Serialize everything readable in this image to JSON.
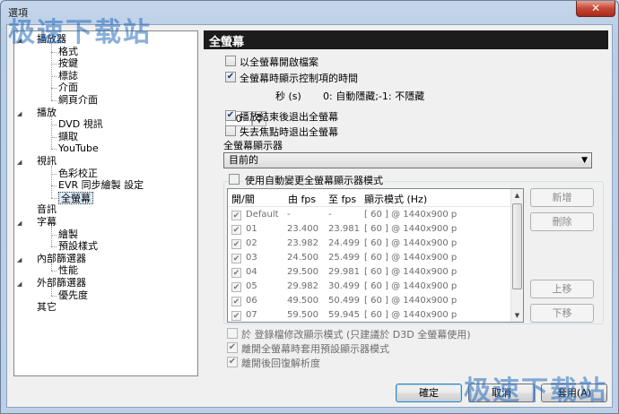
{
  "window": {
    "title": "選項",
    "close_glyph": "✕"
  },
  "watermark": "极速下载站",
  "tree": {
    "items": [
      {
        "label": "播放器",
        "indent": 0,
        "expanded": true
      },
      {
        "label": "格式",
        "indent": 1
      },
      {
        "label": "按鍵",
        "indent": 1
      },
      {
        "label": "標誌",
        "indent": 1
      },
      {
        "label": "介面",
        "indent": 1
      },
      {
        "label": "網頁介面",
        "indent": 1
      },
      {
        "label": "播放",
        "indent": 0,
        "expanded": true
      },
      {
        "label": "DVD 視訊",
        "indent": 1
      },
      {
        "label": "擷取",
        "indent": 1
      },
      {
        "label": "YouTube",
        "indent": 1
      },
      {
        "label": "視訊",
        "indent": 0,
        "expanded": true
      },
      {
        "label": "色彩校正",
        "indent": 1
      },
      {
        "label": "EVR 同步繪製 設定",
        "indent": 1
      },
      {
        "label": "全螢幕",
        "indent": 1,
        "selected": true
      },
      {
        "label": "音訊",
        "indent": 0
      },
      {
        "label": "字幕",
        "indent": 0,
        "expanded": true
      },
      {
        "label": "繪製",
        "indent": 1
      },
      {
        "label": "預設樣式",
        "indent": 1
      },
      {
        "label": "內部篩選器",
        "indent": 0,
        "expanded": true
      },
      {
        "label": "性能",
        "indent": 1
      },
      {
        "label": "外部篩選器",
        "indent": 0,
        "expanded": true
      },
      {
        "label": "優先度",
        "indent": 1
      },
      {
        "label": "其它",
        "indent": 0
      }
    ]
  },
  "panel": {
    "title": "全螢幕",
    "open_fullscreen": {
      "label": "以全螢幕開啟檔案",
      "checked": false
    },
    "show_controls_time": {
      "label": "全螢幕時顯示控制項的時間",
      "checked": true
    },
    "time_value": "0",
    "time_unit": "秒 (s)",
    "time_hint": "0: 自動隱藏;-1: 不隱藏",
    "exit_after_play": {
      "label": "播放結束後退出全螢幕",
      "checked": true
    },
    "exit_on_focus_loss": {
      "label": "失去焦點時退出全螢幕",
      "checked": false
    },
    "monitor_label": "全螢幕顯示器",
    "monitor_value": "目前的",
    "auto_change": {
      "label": "使用自動變更全螢幕顯示器模式",
      "checked": false
    },
    "list": {
      "headers": [
        "開/關",
        "由 fps",
        "至 fps",
        "顯示模式 (Hz)"
      ],
      "rows": [
        {
          "name": "Default",
          "from": "-",
          "to": "-",
          "mode": "[ 60 ]  @ 1440x900 p"
        },
        {
          "name": "01",
          "from": "23.400",
          "to": "23.981",
          "mode": "[ 60 ]  @ 1440x900 p"
        },
        {
          "name": "02",
          "from": "23.982",
          "to": "24.499",
          "mode": "[ 60 ]  @ 1440x900 p"
        },
        {
          "name": "03",
          "from": "24.500",
          "to": "25.499",
          "mode": "[ 60 ]  @ 1440x900 p"
        },
        {
          "name": "04",
          "from": "29.500",
          "to": "29.981",
          "mode": "[ 60 ]  @ 1440x900 p"
        },
        {
          "name": "05",
          "from": "29.982",
          "to": "30.499",
          "mode": "[ 60 ]  @ 1440x900 p"
        },
        {
          "name": "06",
          "from": "49.500",
          "to": "50.499",
          "mode": "[ 60 ]  @ 1440x900 p"
        },
        {
          "name": "07",
          "from": "59.500",
          "to": "59.945",
          "mode": "[ 60 ]  @ 1440x900 p"
        }
      ]
    },
    "btn_new": "新增",
    "btn_delete": "刪除",
    "btn_up": "上移",
    "btn_down": "下移",
    "on_register": {
      "label": "於 登錄檔修改顯示模式 (只建議於 D3D 全螢幕使用)",
      "checked": false
    },
    "restore_default_on_exit": {
      "label": "離開全螢幕時套用預設顯示器模式",
      "checked": true
    },
    "restore_resolution": {
      "label": "離開後回復解析度",
      "checked": true
    }
  },
  "footer": {
    "ok": "確定",
    "cancel": "取消",
    "apply": "套用(A)"
  }
}
